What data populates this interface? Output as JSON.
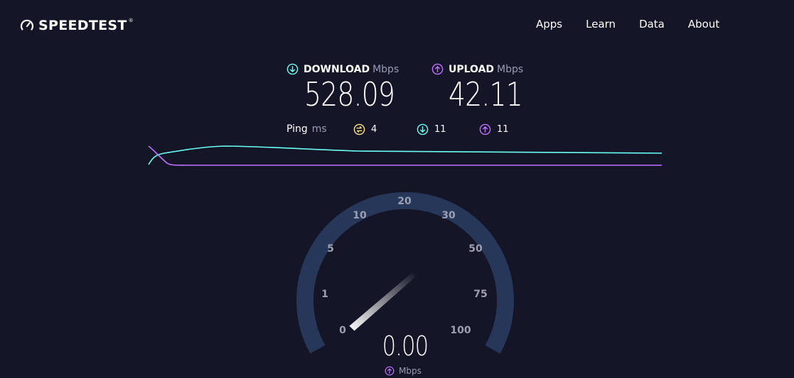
{
  "header": {
    "logo_text": "SPEEDTEST",
    "logo_tm": "®",
    "nav": [
      "Apps",
      "Learn",
      "Data",
      "About"
    ]
  },
  "results": {
    "download": {
      "label": "DOWNLOAD",
      "unit": "Mbps",
      "value": "528.09",
      "color": "#6afff3"
    },
    "upload": {
      "label": "UPLOAD",
      "unit": "Mbps",
      "value": "42.11",
      "color": "#bf71ff"
    }
  },
  "ping": {
    "label": "Ping",
    "unit": "ms",
    "idle": "4",
    "download": "11",
    "upload": "11",
    "idle_color": "#ffe18a"
  },
  "gauge": {
    "labels": [
      "0",
      "1",
      "5",
      "10",
      "20",
      "30",
      "50",
      "75",
      "100"
    ],
    "value": "0.00",
    "unit": "Mbps",
    "needle_value": 0
  },
  "colors": {
    "background": "#141526",
    "gauge_track": "#26375a",
    "download": "#6afff3",
    "upload": "#bf71ff"
  }
}
